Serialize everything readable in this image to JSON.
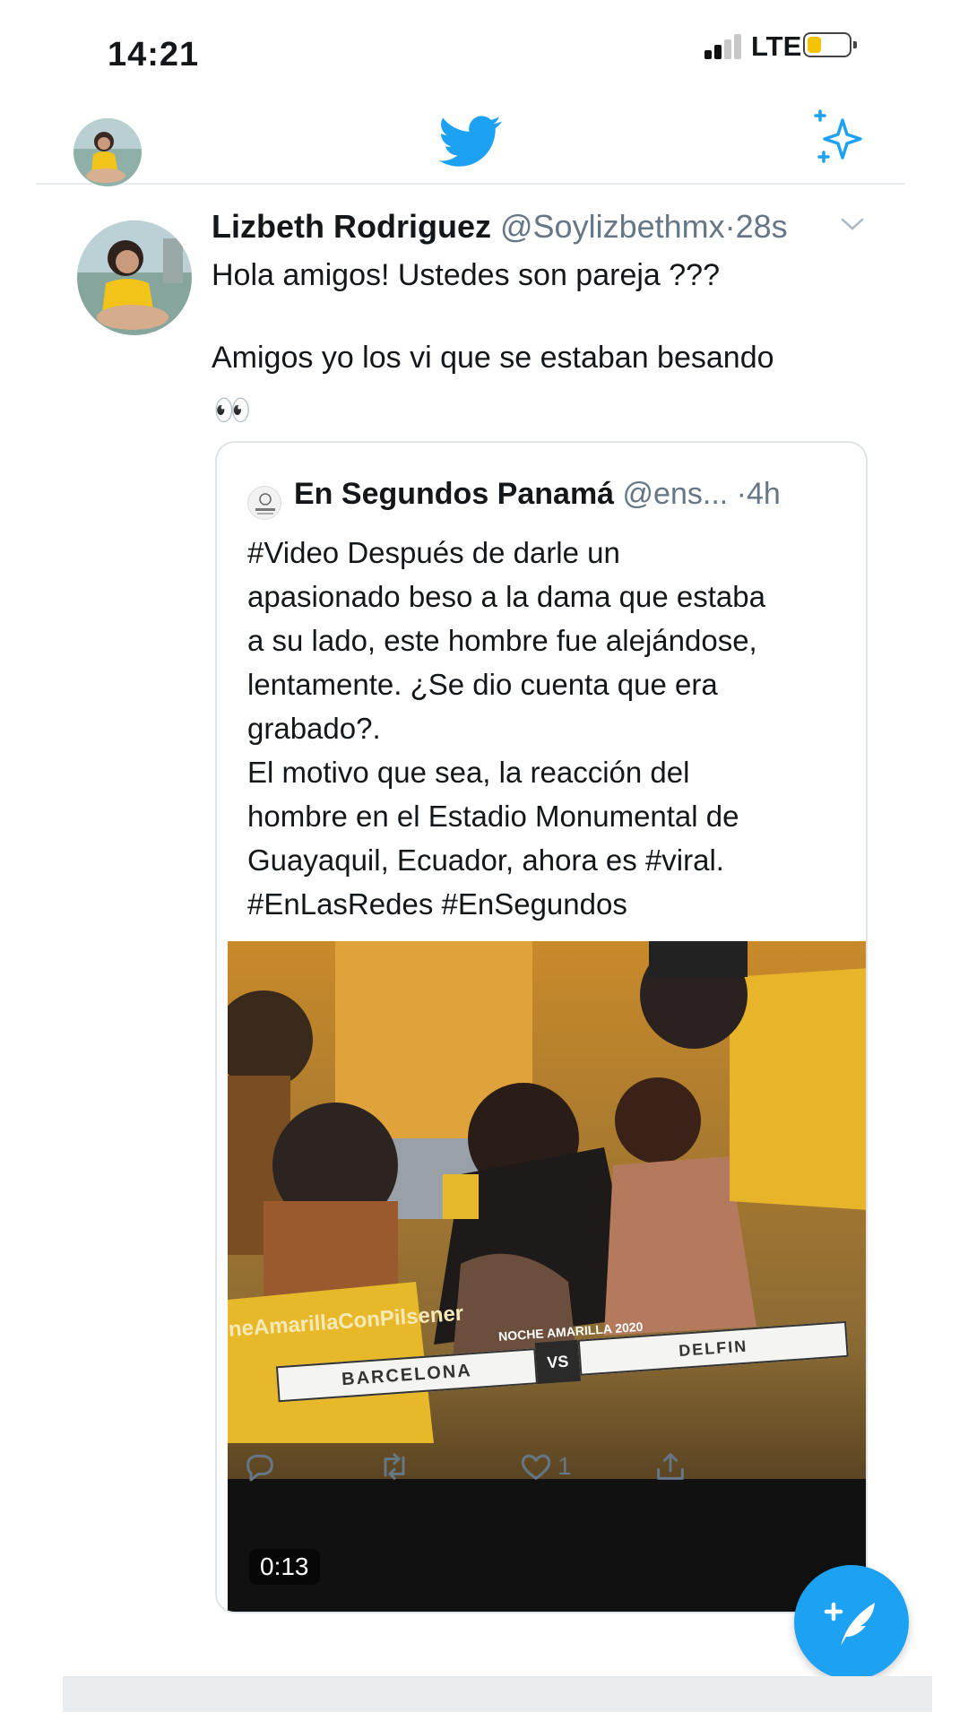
{
  "status_bar": {
    "time": "14:21",
    "network": "LTE",
    "battery_level": 0.35
  },
  "nav": {
    "logo_icon": "twitter-bird-icon",
    "sparkle_icon": "sparkle-icon"
  },
  "tweet": {
    "display_name": "Lizbeth Rodriguez",
    "handle": "@Soylizbethmx",
    "separator": "·",
    "time": "28s",
    "text": "Hola amigos! Ustedes son pareja ???\n\nAmigos yo los vi que se estaban besando",
    "emoji": "👀"
  },
  "quote": {
    "display_name": "En Segundos Panamá",
    "handle": "@ens...",
    "separator": "·",
    "time": "4h",
    "text": "#Video Después de darle un\napasionado beso a la dama que estaba\na su lado, este hombre fue alejándose,\nlentamente. ¿Se dio cuenta que era\ngrabado?.\nEl motivo que sea, la reacción del\nhombre en el Estadio Monumental de\nGuayaquil, Ecuador, ahora es #viral.\n#EnLasRedes #EnSegundos",
    "video_duration": "0:13",
    "video_overlay": {
      "banner_left": "neAmarillaConPilsener",
      "event": "NOCHE AMARILLA 2020",
      "team_home": "BARCELONA",
      "vs": "VS",
      "team_away": "DELFIN"
    }
  },
  "actions": {
    "like_count": "1"
  },
  "colors": {
    "brand": "#1da1f2",
    "secondary_text": "#657786"
  }
}
